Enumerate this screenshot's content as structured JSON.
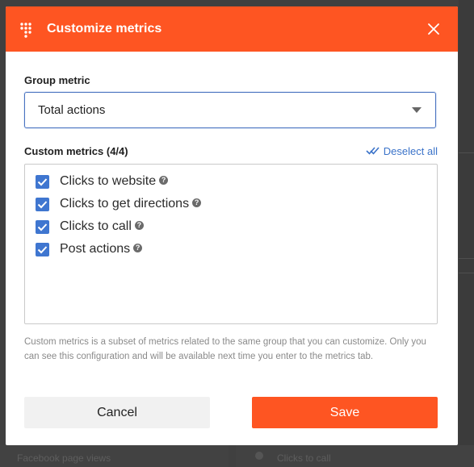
{
  "background": {
    "left_label": "Facebook page views",
    "right_label": "Clicks to call"
  },
  "modal": {
    "title": "Customize metrics",
    "accent_color": "#fe5522",
    "icons": {
      "header": "grid-dots-icon",
      "close": "close-icon"
    }
  },
  "group_metric": {
    "label": "Group metric",
    "selected": "Total actions"
  },
  "custom_metrics": {
    "label": "Custom metrics (4/4)",
    "deselect_all": "Deselect all",
    "items": [
      {
        "label": "Clicks to website",
        "checked": true
      },
      {
        "label": "Clicks to get directions",
        "checked": true
      },
      {
        "label": "Clicks to call",
        "checked": true
      },
      {
        "label": "Post actions",
        "checked": true
      }
    ]
  },
  "help_text": "Custom metrics is a subset of metrics related to the same group that you can customize. Only you can see this configuration and will be available next time you enter to the metrics tab.",
  "actions": {
    "cancel": "Cancel",
    "save": "Save"
  }
}
